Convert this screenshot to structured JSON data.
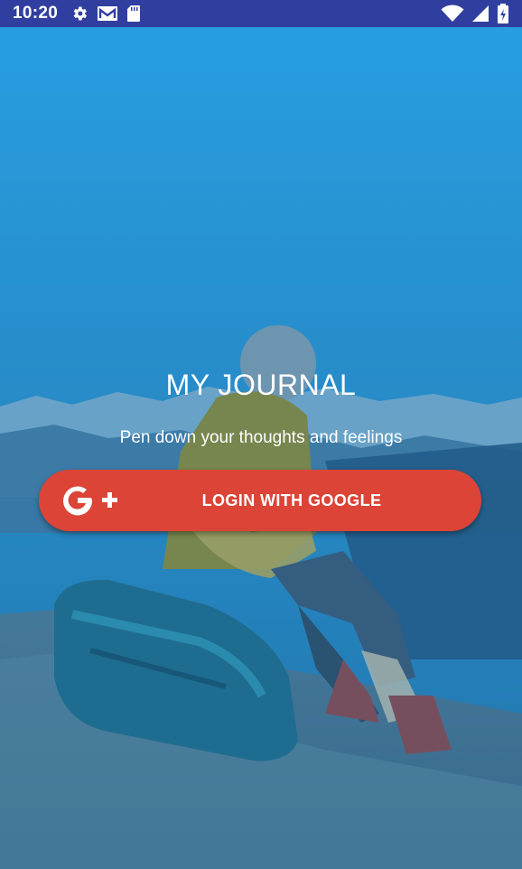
{
  "status_bar": {
    "time": "10:20",
    "left_icons": [
      "gear-icon",
      "gmail-icon",
      "sd-card-icon"
    ],
    "right_icons": [
      "wifi-icon",
      "cell-signal-icon",
      "battery-icon"
    ]
  },
  "app": {
    "title": "MY JOURNAL",
    "subtitle": "Pen down your thoughts and feelings",
    "login_button": {
      "label": "LOGIN WITH GOOGLE",
      "icon": "google-plus-icon",
      "color": "#db4437"
    }
  },
  "colors": {
    "status_bar": "#303f9f",
    "overlay_top": "#29a9ef",
    "overlay_bottom": "#1a5f8e"
  }
}
